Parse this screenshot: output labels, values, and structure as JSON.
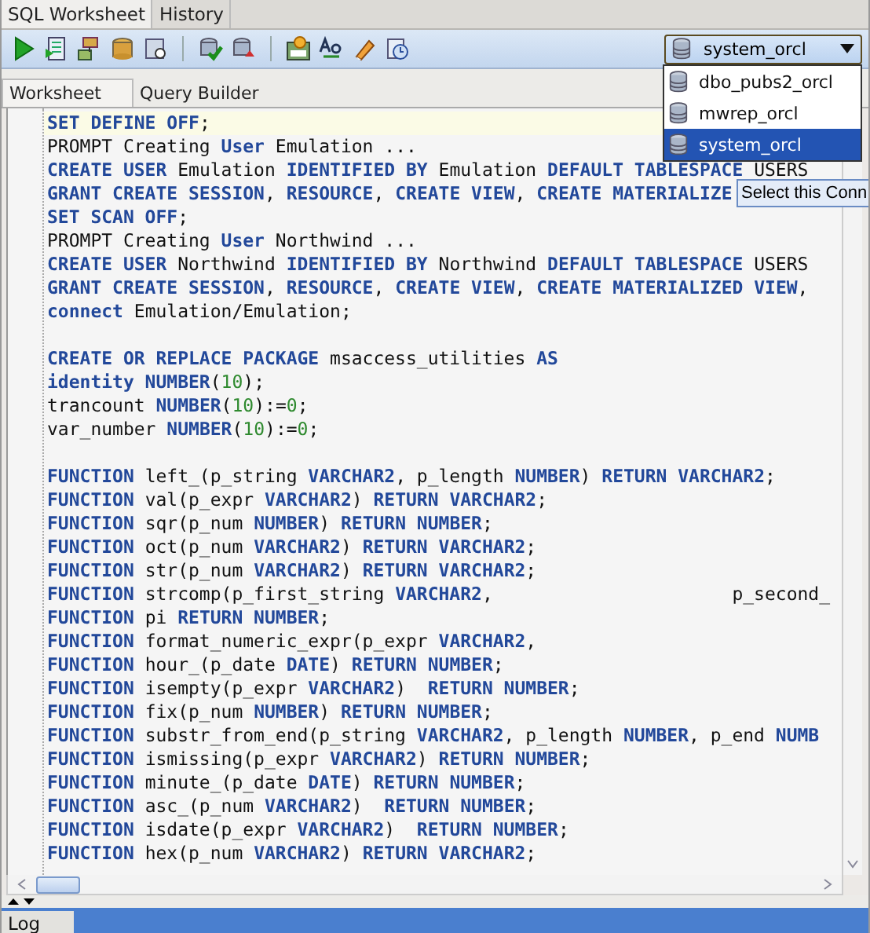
{
  "top_tabs": [
    {
      "label": "SQL Worksheet",
      "selected": true
    },
    {
      "label": "History",
      "selected": false
    }
  ],
  "connection": {
    "value": "system_orcl",
    "expanded": true,
    "options": [
      {
        "label": "dbo_pubs2_orcl",
        "selected": false
      },
      {
        "label": "mwrep_orcl",
        "selected": false
      },
      {
        "label": "system_orcl",
        "selected": true
      }
    ]
  },
  "tooltip": "Select this Conn",
  "editor_tabs": [
    {
      "label": "Worksheet",
      "selected": true
    },
    {
      "label": "Query Builder",
      "selected": false
    }
  ],
  "code_lines": [
    {
      "kind": "code",
      "current": true,
      "tokens": [
        {
          "kind": "keyword",
          "text": "SET DEFINE OFF"
        },
        {
          "kind": "plain",
          "text": ";"
        }
      ]
    },
    {
      "kind": "code",
      "current": false,
      "tokens": [
        {
          "kind": "plain",
          "text": "PROMPT Creating "
        },
        {
          "kind": "keyword",
          "text": "User"
        },
        {
          "kind": "plain",
          "text": " Emulation ..."
        }
      ]
    },
    {
      "kind": "code",
      "current": false,
      "tokens": [
        {
          "kind": "keyword",
          "text": "CREATE USER"
        },
        {
          "kind": "plain",
          "text": " Emulation "
        },
        {
          "kind": "keyword",
          "text": "IDENTIFIED BY"
        },
        {
          "kind": "plain",
          "text": " Emulation "
        },
        {
          "kind": "keyword",
          "text": "DEFAULT TABLESPACE"
        },
        {
          "kind": "plain",
          "text": " USERS"
        }
      ]
    },
    {
      "kind": "code",
      "current": false,
      "tokens": [
        {
          "kind": "keyword",
          "text": "GRANT CREATE SESSION"
        },
        {
          "kind": "plain",
          "text": ", "
        },
        {
          "kind": "keyword",
          "text": "RESOURCE"
        },
        {
          "kind": "plain",
          "text": ", "
        },
        {
          "kind": "keyword",
          "text": "CREATE VIEW"
        },
        {
          "kind": "plain",
          "text": ", "
        },
        {
          "kind": "keyword",
          "text": "CREATE MATERIALIZE"
        }
      ]
    },
    {
      "kind": "code",
      "current": false,
      "tokens": [
        {
          "kind": "keyword",
          "text": "SET SCAN OFF"
        },
        {
          "kind": "plain",
          "text": ";"
        }
      ]
    },
    {
      "kind": "code",
      "current": false,
      "tokens": [
        {
          "kind": "plain",
          "text": "PROMPT Creating "
        },
        {
          "kind": "keyword",
          "text": "User"
        },
        {
          "kind": "plain",
          "text": " Northwind ..."
        }
      ]
    },
    {
      "kind": "code",
      "current": false,
      "tokens": [
        {
          "kind": "keyword",
          "text": "CREATE USER"
        },
        {
          "kind": "plain",
          "text": " Northwind "
        },
        {
          "kind": "keyword",
          "text": "IDENTIFIED BY"
        },
        {
          "kind": "plain",
          "text": " Northwind "
        },
        {
          "kind": "keyword",
          "text": "DEFAULT TABLESPACE"
        },
        {
          "kind": "plain",
          "text": " USERS"
        }
      ]
    },
    {
      "kind": "code",
      "current": false,
      "tokens": [
        {
          "kind": "keyword",
          "text": "GRANT CREATE SESSION"
        },
        {
          "kind": "plain",
          "text": ", "
        },
        {
          "kind": "keyword",
          "text": "RESOURCE"
        },
        {
          "kind": "plain",
          "text": ", "
        },
        {
          "kind": "keyword",
          "text": "CREATE VIEW"
        },
        {
          "kind": "plain",
          "text": ", "
        },
        {
          "kind": "keyword",
          "text": "CREATE MATERIALIZED VIEW"
        },
        {
          "kind": "plain",
          "text": ","
        }
      ]
    },
    {
      "kind": "code",
      "current": false,
      "tokens": [
        {
          "kind": "keyword",
          "text": "connect"
        },
        {
          "kind": "plain",
          "text": " Emulation/Emulation;"
        }
      ]
    },
    {
      "kind": "blank"
    },
    {
      "kind": "code",
      "current": false,
      "tokens": [
        {
          "kind": "keyword",
          "text": "CREATE OR REPLACE PACKAGE"
        },
        {
          "kind": "plain",
          "text": " msaccess_utilities "
        },
        {
          "kind": "keyword",
          "text": "AS"
        }
      ]
    },
    {
      "kind": "code",
      "current": false,
      "tokens": [
        {
          "kind": "keyword",
          "text": "identity NUMBER"
        },
        {
          "kind": "plain",
          "text": "("
        },
        {
          "kind": "number",
          "text": "10"
        },
        {
          "kind": "plain",
          "text": ");"
        }
      ]
    },
    {
      "kind": "code",
      "current": false,
      "tokens": [
        {
          "kind": "plain",
          "text": "trancount "
        },
        {
          "kind": "keyword",
          "text": "NUMBER"
        },
        {
          "kind": "plain",
          "text": "("
        },
        {
          "kind": "number",
          "text": "10"
        },
        {
          "kind": "plain",
          "text": "):="
        },
        {
          "kind": "number",
          "text": "0"
        },
        {
          "kind": "plain",
          "text": ";"
        }
      ]
    },
    {
      "kind": "code",
      "current": false,
      "tokens": [
        {
          "kind": "plain",
          "text": "var_number "
        },
        {
          "kind": "keyword",
          "text": "NUMBER"
        },
        {
          "kind": "plain",
          "text": "("
        },
        {
          "kind": "number",
          "text": "10"
        },
        {
          "kind": "plain",
          "text": "):="
        },
        {
          "kind": "number",
          "text": "0"
        },
        {
          "kind": "plain",
          "text": ";"
        }
      ]
    },
    {
      "kind": "blank"
    },
    {
      "kind": "code",
      "current": false,
      "tokens": [
        {
          "kind": "keyword",
          "text": "FUNCTION"
        },
        {
          "kind": "plain",
          "text": " left_(p_string "
        },
        {
          "kind": "keyword",
          "text": "VARCHAR2"
        },
        {
          "kind": "plain",
          "text": ", p_length "
        },
        {
          "kind": "keyword",
          "text": "NUMBER"
        },
        {
          "kind": "plain",
          "text": ") "
        },
        {
          "kind": "keyword",
          "text": "RETURN VARCHAR2"
        },
        {
          "kind": "plain",
          "text": ";"
        }
      ]
    },
    {
      "kind": "code",
      "current": false,
      "tokens": [
        {
          "kind": "keyword",
          "text": "FUNCTION"
        },
        {
          "kind": "plain",
          "text": " val(p_expr "
        },
        {
          "kind": "keyword",
          "text": "VARCHAR2"
        },
        {
          "kind": "plain",
          "text": ") "
        },
        {
          "kind": "keyword",
          "text": "RETURN VARCHAR2"
        },
        {
          "kind": "plain",
          "text": ";"
        }
      ]
    },
    {
      "kind": "code",
      "current": false,
      "tokens": [
        {
          "kind": "keyword",
          "text": "FUNCTION"
        },
        {
          "kind": "plain",
          "text": " sqr(p_num "
        },
        {
          "kind": "keyword",
          "text": "NUMBER"
        },
        {
          "kind": "plain",
          "text": ") "
        },
        {
          "kind": "keyword",
          "text": "RETURN NUMBER"
        },
        {
          "kind": "plain",
          "text": ";"
        }
      ]
    },
    {
      "kind": "code",
      "current": false,
      "tokens": [
        {
          "kind": "keyword",
          "text": "FUNCTION"
        },
        {
          "kind": "plain",
          "text": " oct(p_num "
        },
        {
          "kind": "keyword",
          "text": "VARCHAR2"
        },
        {
          "kind": "plain",
          "text": ") "
        },
        {
          "kind": "keyword",
          "text": "RETURN VARCHAR2"
        },
        {
          "kind": "plain",
          "text": ";"
        }
      ]
    },
    {
      "kind": "code",
      "current": false,
      "tokens": [
        {
          "kind": "keyword",
          "text": "FUNCTION"
        },
        {
          "kind": "plain",
          "text": " str(p_num "
        },
        {
          "kind": "keyword",
          "text": "VARCHAR2"
        },
        {
          "kind": "plain",
          "text": ") "
        },
        {
          "kind": "keyword",
          "text": "RETURN VARCHAR2"
        },
        {
          "kind": "plain",
          "text": ";"
        }
      ]
    },
    {
      "kind": "code",
      "current": false,
      "tokens": [
        {
          "kind": "keyword",
          "text": "FUNCTION"
        },
        {
          "kind": "plain",
          "text": " strcomp(p_first_string "
        },
        {
          "kind": "keyword",
          "text": "VARCHAR2"
        },
        {
          "kind": "plain",
          "text": ",                      p_second_"
        }
      ]
    },
    {
      "kind": "code",
      "current": false,
      "tokens": [
        {
          "kind": "keyword",
          "text": "FUNCTION"
        },
        {
          "kind": "plain",
          "text": " pi "
        },
        {
          "kind": "keyword",
          "text": "RETURN NUMBER"
        },
        {
          "kind": "plain",
          "text": ";"
        }
      ]
    },
    {
      "kind": "code",
      "current": false,
      "tokens": [
        {
          "kind": "keyword",
          "text": "FUNCTION"
        },
        {
          "kind": "plain",
          "text": " format_numeric_expr(p_expr "
        },
        {
          "kind": "keyword",
          "text": "VARCHAR2"
        },
        {
          "kind": "plain",
          "text": ","
        }
      ]
    },
    {
      "kind": "code",
      "current": false,
      "tokens": [
        {
          "kind": "keyword",
          "text": "FUNCTION"
        },
        {
          "kind": "plain",
          "text": " hour_(p_date "
        },
        {
          "kind": "keyword",
          "text": "DATE"
        },
        {
          "kind": "plain",
          "text": ") "
        },
        {
          "kind": "keyword",
          "text": "RETURN NUMBER"
        },
        {
          "kind": "plain",
          "text": ";"
        }
      ]
    },
    {
      "kind": "code",
      "current": false,
      "tokens": [
        {
          "kind": "keyword",
          "text": "FUNCTION"
        },
        {
          "kind": "plain",
          "text": " isempty(p_expr "
        },
        {
          "kind": "keyword",
          "text": "VARCHAR2"
        },
        {
          "kind": "plain",
          "text": ")  "
        },
        {
          "kind": "keyword",
          "text": "RETURN NUMBER"
        },
        {
          "kind": "plain",
          "text": ";"
        }
      ]
    },
    {
      "kind": "code",
      "current": false,
      "tokens": [
        {
          "kind": "keyword",
          "text": "FUNCTION"
        },
        {
          "kind": "plain",
          "text": " fix(p_num "
        },
        {
          "kind": "keyword",
          "text": "NUMBER"
        },
        {
          "kind": "plain",
          "text": ") "
        },
        {
          "kind": "keyword",
          "text": "RETURN NUMBER"
        },
        {
          "kind": "plain",
          "text": ";"
        }
      ]
    },
    {
      "kind": "code",
      "current": false,
      "tokens": [
        {
          "kind": "keyword",
          "text": "FUNCTION"
        },
        {
          "kind": "plain",
          "text": " substr_from_end(p_string "
        },
        {
          "kind": "keyword",
          "text": "VARCHAR2"
        },
        {
          "kind": "plain",
          "text": ", p_length "
        },
        {
          "kind": "keyword",
          "text": "NUMBER"
        },
        {
          "kind": "plain",
          "text": ", p_end "
        },
        {
          "kind": "keyword",
          "text": "NUMB"
        }
      ]
    },
    {
      "kind": "code",
      "current": false,
      "tokens": [
        {
          "kind": "keyword",
          "text": "FUNCTION"
        },
        {
          "kind": "plain",
          "text": " ismissing(p_expr "
        },
        {
          "kind": "keyword",
          "text": "VARCHAR2"
        },
        {
          "kind": "plain",
          "text": ") "
        },
        {
          "kind": "keyword",
          "text": "RETURN NUMBER"
        },
        {
          "kind": "plain",
          "text": ";"
        }
      ]
    },
    {
      "kind": "code",
      "current": false,
      "tokens": [
        {
          "kind": "keyword",
          "text": "FUNCTION"
        },
        {
          "kind": "plain",
          "text": " minute_(p_date "
        },
        {
          "kind": "keyword",
          "text": "DATE"
        },
        {
          "kind": "plain",
          "text": ") "
        },
        {
          "kind": "keyword",
          "text": "RETURN NUMBER"
        },
        {
          "kind": "plain",
          "text": ";"
        }
      ]
    },
    {
      "kind": "code",
      "current": false,
      "tokens": [
        {
          "kind": "keyword",
          "text": "FUNCTION"
        },
        {
          "kind": "plain",
          "text": " asc_(p_num "
        },
        {
          "kind": "keyword",
          "text": "VARCHAR2"
        },
        {
          "kind": "plain",
          "text": ")  "
        },
        {
          "kind": "keyword",
          "text": "RETURN NUMBER"
        },
        {
          "kind": "plain",
          "text": ";"
        }
      ]
    },
    {
      "kind": "code",
      "current": false,
      "tokens": [
        {
          "kind": "keyword",
          "text": "FUNCTION"
        },
        {
          "kind": "plain",
          "text": " isdate(p_expr "
        },
        {
          "kind": "keyword",
          "text": "VARCHAR2"
        },
        {
          "kind": "plain",
          "text": ")  "
        },
        {
          "kind": "keyword",
          "text": "RETURN NUMBER"
        },
        {
          "kind": "plain",
          "text": ";"
        }
      ]
    },
    {
      "kind": "code",
      "current": false,
      "tokens": [
        {
          "kind": "keyword",
          "text": "FUNCTION"
        },
        {
          "kind": "plain",
          "text": " hex(p_num "
        },
        {
          "kind": "keyword",
          "text": "VARCHAR2"
        },
        {
          "kind": "plain",
          "text": ") "
        },
        {
          "kind": "keyword",
          "text": "RETURN VARCHAR2"
        },
        {
          "kind": "plain",
          "text": ";"
        }
      ]
    }
  ],
  "bottom_tabs": [
    {
      "label": "Log"
    }
  ]
}
